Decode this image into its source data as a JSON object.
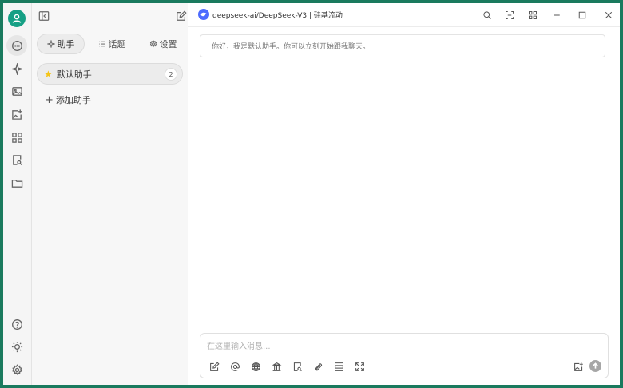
{
  "colors": {
    "frame": "#1a7a5e",
    "avatar": "#16a085",
    "model_logo": "#4d6bfe",
    "star": "#f5c518"
  },
  "rail": {
    "items": [
      {
        "icon": "chat-bubble-icon",
        "active": true
      },
      {
        "icon": "sparkle-icon"
      },
      {
        "icon": "image-icon"
      },
      {
        "icon": "image-plus-icon"
      },
      {
        "icon": "apps-grid-icon"
      },
      {
        "icon": "document-search-icon"
      },
      {
        "icon": "folder-icon"
      }
    ],
    "bottom": [
      {
        "icon": "help-icon"
      },
      {
        "icon": "sun-icon"
      },
      {
        "icon": "gear-icon"
      }
    ]
  },
  "panel": {
    "tabs": [
      {
        "label": "助手",
        "icon": "sparkle-icon",
        "active": true
      },
      {
        "label": "话题",
        "icon": "list-icon"
      },
      {
        "label": "设置",
        "icon": "gear-icon"
      }
    ],
    "assistant": {
      "name": "默认助手",
      "count": "2"
    },
    "add_label": "添加助手"
  },
  "header": {
    "model_title": "deepseek-ai/DeepSeek-V3 | 硅基流动"
  },
  "chat": {
    "greeting": "你好，我是默认助手。你可以立刻开始跟我聊天。",
    "input_placeholder": "在这里输入消息..."
  }
}
